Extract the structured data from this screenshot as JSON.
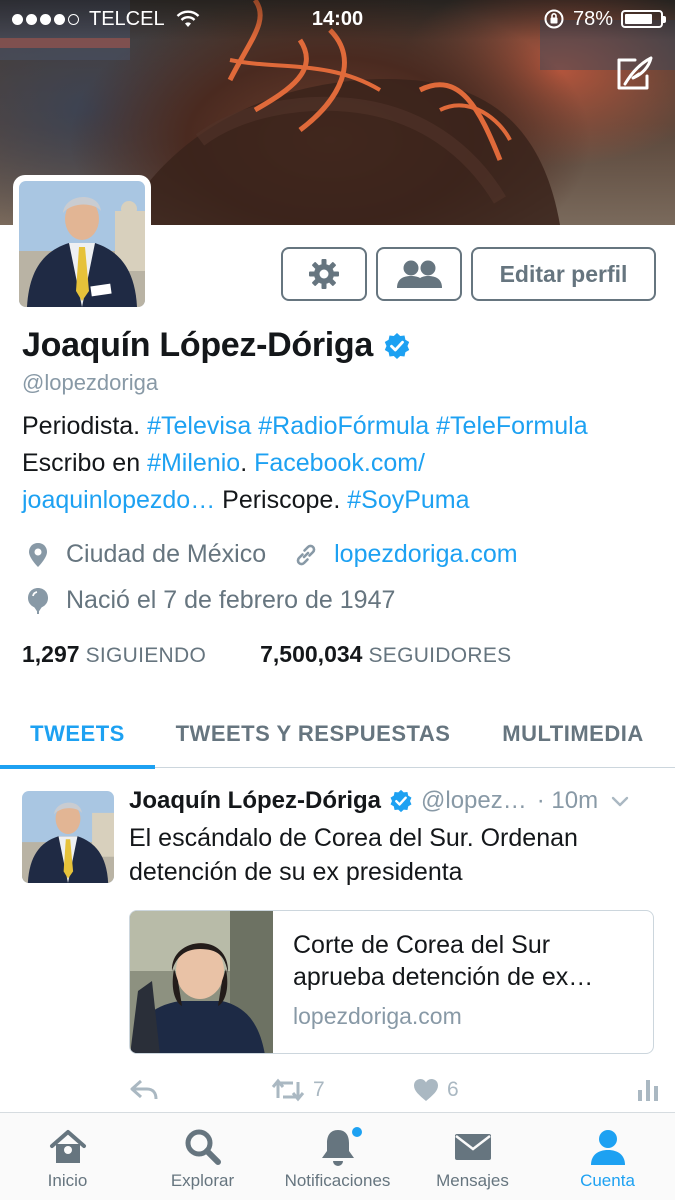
{
  "status_bar": {
    "carrier": "TELCEL",
    "time": "14:00",
    "battery_percent": "78%",
    "battery_level": 0.78,
    "signal_bars_filled": 4,
    "signal_bars_total": 5
  },
  "profile": {
    "name": "Joaquín López-Dóriga",
    "handle": "@lopezdoriga",
    "verified": true,
    "edit_profile_label": "Editar perfil",
    "bio": {
      "line1_text": "Periodista.",
      "line1_tags": [
        "#Televisa",
        "#RadioFórmula",
        "#TeleFormula"
      ],
      "line2_text": "Escribo en",
      "line2_tag": "#Milenio",
      "line2_dot": ".",
      "line2_link": "Facebook.com/",
      "line3_link": "joaquinlopezdo…",
      "line3_text": "Periscope.",
      "line3_tag": "#SoyPuma"
    },
    "location": "Ciudad de México",
    "website": "lopezdoriga.com",
    "birthday": "Nació el 7 de febrero de 1947",
    "following_count": "1,297",
    "following_label": "SIGUIENDO",
    "followers_count": "7,500,034",
    "followers_label": "SEGUIDORES"
  },
  "tabs": [
    {
      "label": "TWEETS",
      "active": true
    },
    {
      "label": "TWEETS Y RESPUESTAS",
      "active": false
    },
    {
      "label": "MULTIMEDIA",
      "active": false
    }
  ],
  "tweet": {
    "author_name": "Joaquín López-Dóriga",
    "author_handle": "@lopez…",
    "time": "· 10m",
    "text": "El escándalo de Corea del Sur. Ordenan detención de su ex presidenta",
    "card": {
      "title": "Corte de Corea del Sur aprueba detención de ex…",
      "domain": "lopezdoriga.com"
    },
    "retweets": "7",
    "likes": "6"
  },
  "tab_bar": [
    {
      "label": "Inicio",
      "icon": "home-icon",
      "active": false
    },
    {
      "label": "Explorar",
      "icon": "search-icon",
      "active": false
    },
    {
      "label": "Notificaciones",
      "icon": "bell-icon",
      "active": false,
      "has_dot": true
    },
    {
      "label": "Mensajes",
      "icon": "envelope-icon",
      "active": false
    },
    {
      "label": "Cuenta",
      "icon": "person-icon",
      "active": true
    }
  ],
  "colors": {
    "accent": "#1da1f2",
    "text": "#14171a",
    "muted": "#66757f",
    "light_muted": "#8899a6"
  }
}
